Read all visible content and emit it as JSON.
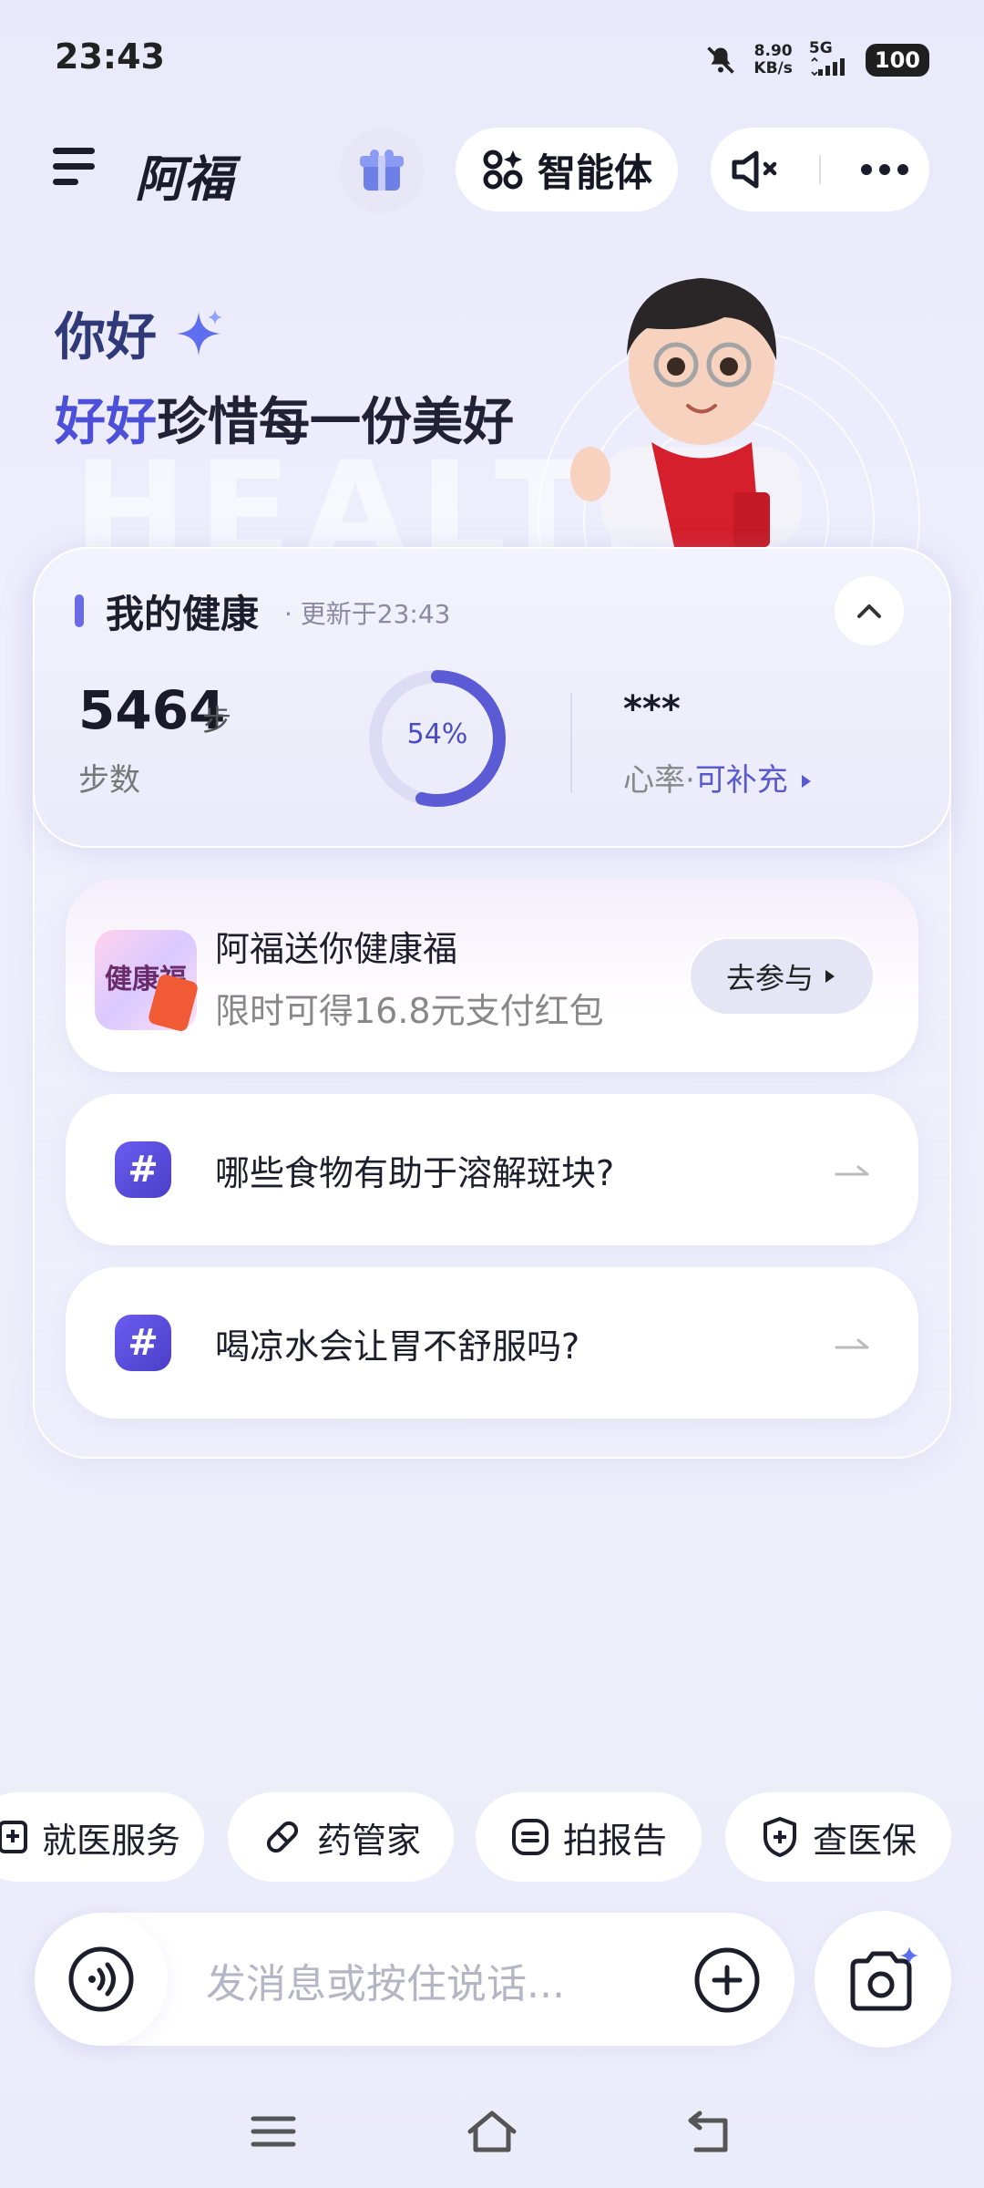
{
  "status_bar": {
    "time": "23:43",
    "net_speed_value": "8.90",
    "net_speed_unit": "KB/s",
    "network": "5G",
    "battery": "100"
  },
  "header": {
    "title": "阿福",
    "agent_label": "智能体"
  },
  "greeting": {
    "line1": "你好",
    "line2_accent": "好好",
    "line2_rest": "珍惜每一份美好",
    "watermark": "HEALTH"
  },
  "health": {
    "title": "我的健康",
    "updated": "· 更新于23:43",
    "steps_value": "5464",
    "steps_unit": "步",
    "steps_label": "步数",
    "progress_percent": 54,
    "progress_text": "54%",
    "heart_rate_value": "***",
    "heart_rate_label": "心率·",
    "heart_rate_link": "可补充",
    "accent_color": "#5b5bd6"
  },
  "promo": {
    "image_text": "健康福",
    "title": "阿福送你健康福",
    "subtitle": "限时可得16.8元支付红包",
    "button": "去参与"
  },
  "questions": [
    {
      "text": "哪些食物有助于溶解斑块?"
    },
    {
      "text": "喝凉水会让胃不舒服吗?"
    }
  ],
  "quick_actions": [
    {
      "label": "就医服务",
      "icon": "hospital-icon"
    },
    {
      "label": "药管家",
      "icon": "pill-icon"
    },
    {
      "label": "拍报告",
      "icon": "report-icon"
    },
    {
      "label": "查医保",
      "icon": "shield-plus-icon"
    }
  ],
  "input": {
    "placeholder": "发消息或按住说话..."
  }
}
